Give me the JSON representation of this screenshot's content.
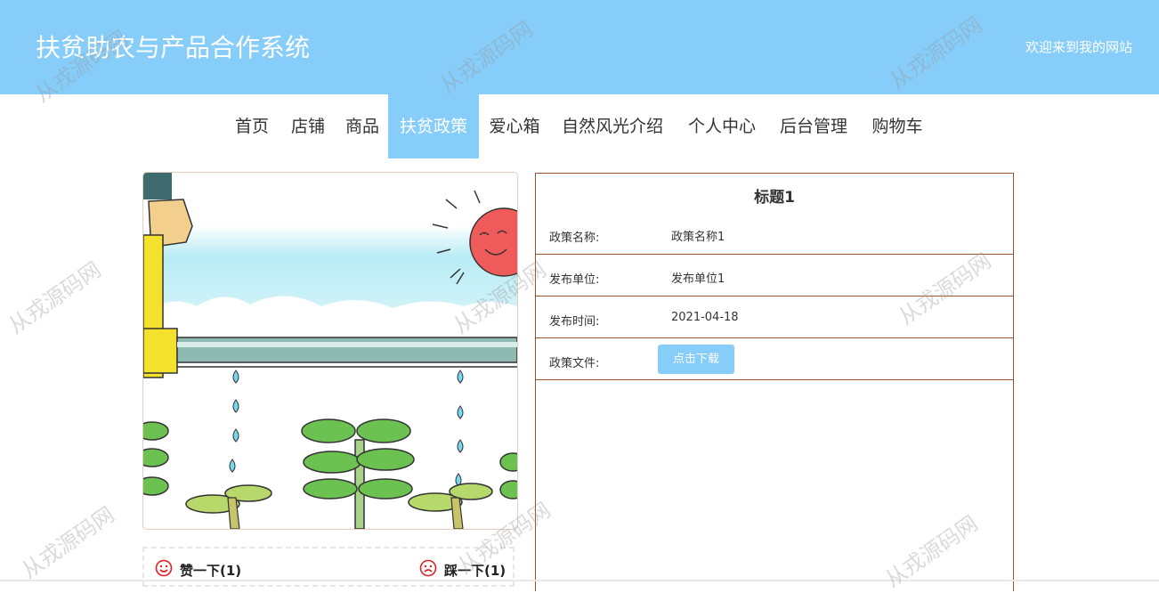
{
  "header": {
    "title": "扶贫助农与产品合作系统",
    "welcome": "欢迎来到我的网站"
  },
  "nav": {
    "items": [
      {
        "label": "首页"
      },
      {
        "label": "店铺"
      },
      {
        "label": "商品"
      },
      {
        "label": "扶贫政策",
        "active": true
      },
      {
        "label": "爱心箱"
      },
      {
        "label": "自然风光介绍"
      },
      {
        "label": "个人中心"
      },
      {
        "label": "后台管理"
      },
      {
        "label": "购物车"
      }
    ]
  },
  "image": {
    "description_icon": "poverty-relief-cartoon-illustration"
  },
  "votes": {
    "like_label": "赞一下(1)",
    "dislike_label": "踩一下(1)"
  },
  "detail": {
    "title": "标题1",
    "rows": [
      {
        "label": "政策名称:",
        "value": "政策名称1"
      },
      {
        "label": "发布单位:",
        "value": "发布单位1"
      },
      {
        "label": "发布时间:",
        "value": "2021-04-18"
      },
      {
        "label": "政策文件:",
        "button": "点击下载"
      }
    ]
  },
  "watermark": "从戎源码网",
  "colors": {
    "accent": "#87cdf9",
    "border": "#a0522d",
    "icon_red": "#e02020"
  }
}
